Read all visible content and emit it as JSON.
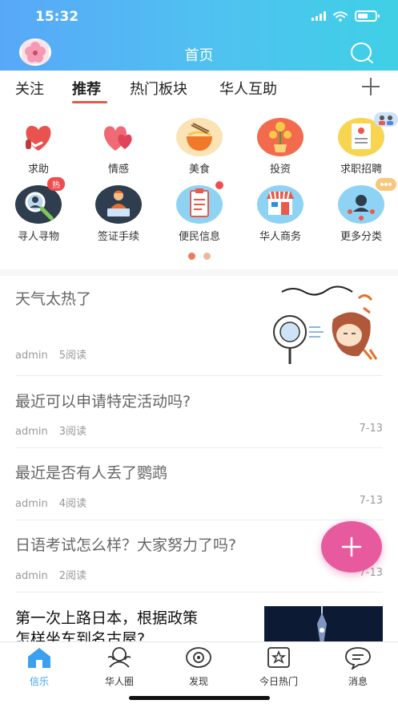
{
  "status_bar": {
    "time": "15:32"
  },
  "header": {
    "title": "首页"
  },
  "tabs": [
    {
      "label": "关注"
    },
    {
      "label": "推荐",
      "active": true
    },
    {
      "label": "热门板块"
    },
    {
      "label": "华人互助"
    }
  ],
  "categories": [
    {
      "label": "求助",
      "icon": "helping-hands-heart-icon"
    },
    {
      "label": "情感",
      "icon": "hearts-icon"
    },
    {
      "label": "美食",
      "icon": "noodle-bowl-icon"
    },
    {
      "label": "投资",
      "icon": "money-plant-icon"
    },
    {
      "label": "求职招聘",
      "icon": "resume-icon"
    },
    {
      "label": "寻人寻物",
      "icon": "person-search-icon",
      "badge": "热"
    },
    {
      "label": "签证手续",
      "icon": "visa-officer-icon"
    },
    {
      "label": "便民信息",
      "icon": "clipboard-icon",
      "dot": true
    },
    {
      "label": "华人商务",
      "icon": "shop-icon"
    },
    {
      "label": "更多分类",
      "icon": "more-categories-icon"
    }
  ],
  "carousel": {
    "pages": 2,
    "active": 1
  },
  "posts": [
    {
      "title": "天气太热了",
      "author": "admin",
      "reads": "5阅读",
      "date": "",
      "thumb": "hot-weather-cartoon"
    },
    {
      "title": "最近可以申请特定活动吗?",
      "author": "admin",
      "reads": "3阅读",
      "date": "7-13"
    },
    {
      "title": "最近是否有人丢了鹦鹉",
      "author": "admin",
      "reads": "4阅读",
      "date": "7-13"
    },
    {
      "title": "日语考试怎么样？大家努力了吗?",
      "author": "admin",
      "reads": "2阅读",
      "date": "7-13"
    },
    {
      "title_line1": "第一次上路日本，根据政策",
      "title_line2": "怎样坐车到名古屋?",
      "thumb": "night-tower-photo"
    }
  ],
  "fab": {
    "icon": "plus-icon"
  },
  "bottom_nav": [
    {
      "label": "信乐",
      "icon": "home-icon",
      "active": true
    },
    {
      "label": "华人圈",
      "icon": "community-icon"
    },
    {
      "label": "发现",
      "icon": "discover-eye-icon"
    },
    {
      "label": "今日热门",
      "icon": "hot-today-icon"
    },
    {
      "label": "消息",
      "icon": "message-icon"
    }
  ],
  "colors": {
    "header_start": "#58a8f8",
    "header_end": "#3fd0e6",
    "tab_underline": "#e05a4a",
    "fab": "#e85a9e",
    "nav_active": "#3ba0ee",
    "hot_badge": "#ef4d4d"
  }
}
